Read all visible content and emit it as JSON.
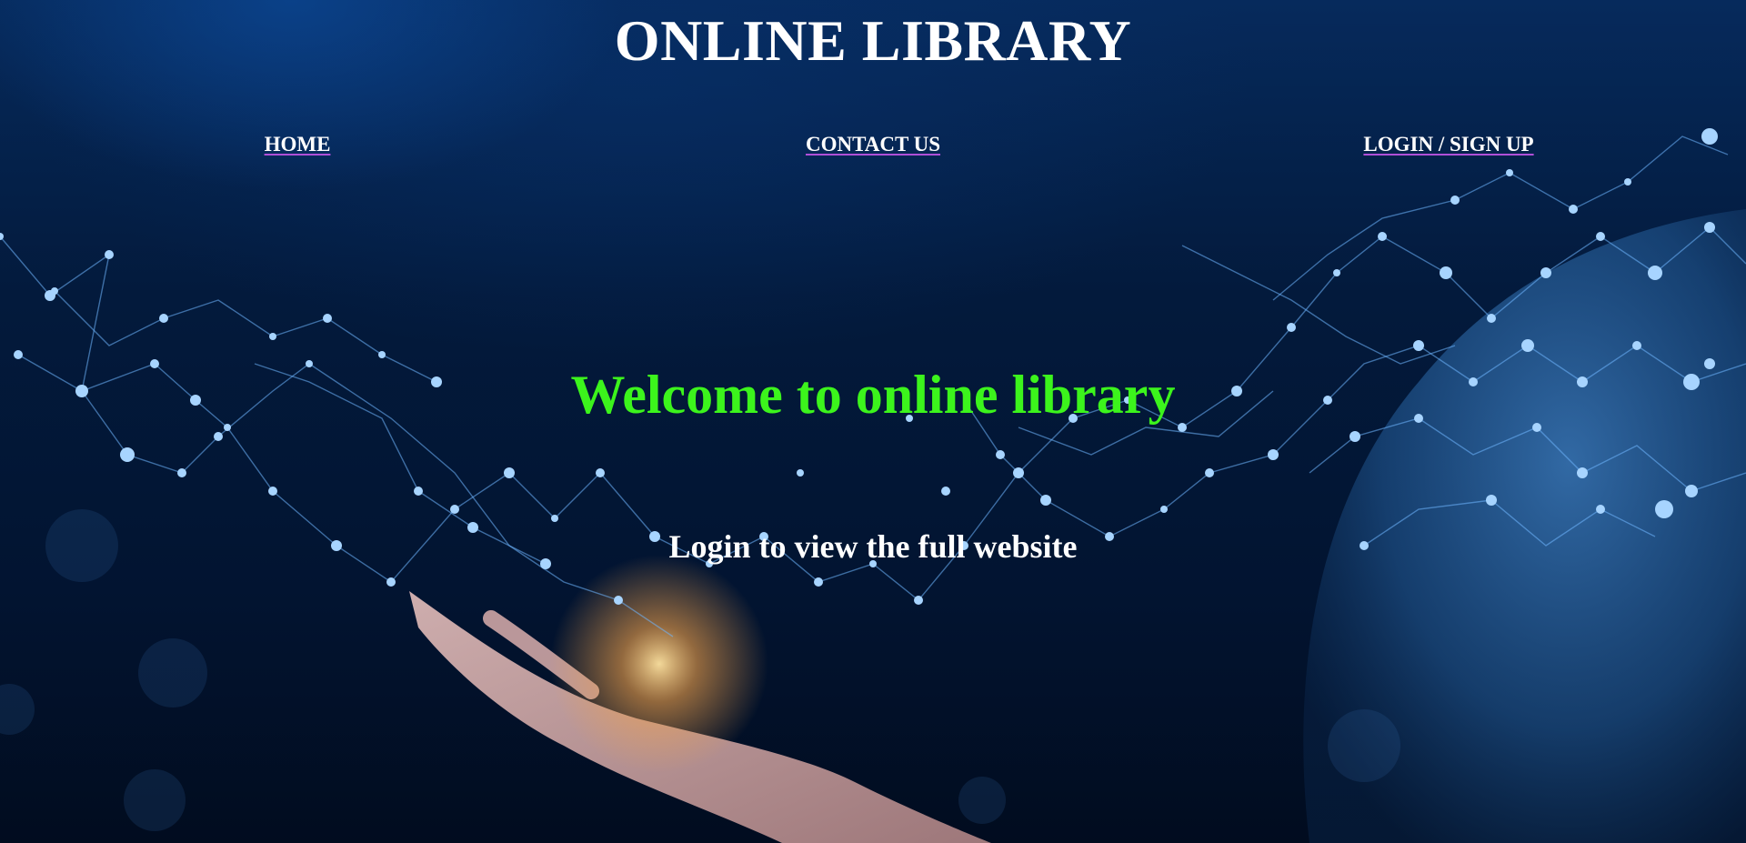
{
  "header": {
    "title": "ONLINE LIBRARY"
  },
  "nav": {
    "home": "HOME",
    "contact": "CONTACT US",
    "login": "LOGIN / SIGN UP"
  },
  "hero": {
    "welcome": "Welcome to online library",
    "subtitle": "Login to view the full website"
  },
  "colors": {
    "background": "#021431",
    "title": "#ffffff",
    "welcome": "#3cf41c",
    "nav_underline": "#b04fd8"
  }
}
